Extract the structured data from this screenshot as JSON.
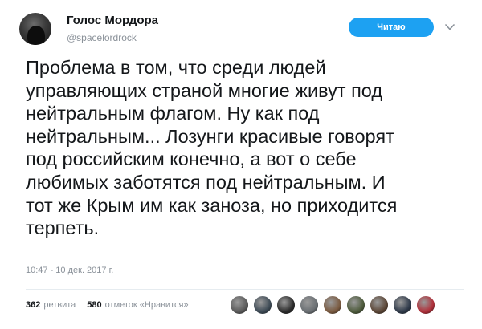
{
  "header": {
    "display_name": "Голос Мордора",
    "handle": "@spacelordrock",
    "follow_label": "Читаю"
  },
  "tweet": {
    "text": "Проблема в том, что среди людей\nуправляющих страной многие живут под\nнейтральным флагом. Ну как под\nнейтральным... Лозунги красивые говорят\nпод российским конечно, а вот о себе\nлюбимых заботятся под нейтральным. И\nтот же Крым им как заноза, но приходится\nтерпеть.",
    "timestamp": "10:47 - 10 дек. 2017 г."
  },
  "stats": {
    "retweets_count": "362",
    "retweets_label": "ретвита",
    "likes_count": "580",
    "likes_label": "отметок «Нравится»"
  },
  "likers": [
    {
      "color": "#5a5a5a"
    },
    {
      "color": "#3d4a55"
    },
    {
      "color": "#2b2b2b"
    },
    {
      "color": "#6a6f73"
    },
    {
      "color": "#7a5a40"
    },
    {
      "color": "#4e5b3c"
    },
    {
      "color": "#5b4636"
    },
    {
      "color": "#2f3a4a"
    },
    {
      "color": "#b0303a"
    }
  ],
  "colors": {
    "accent": "#1da1f2",
    "secondary_text": "#8a9199"
  }
}
